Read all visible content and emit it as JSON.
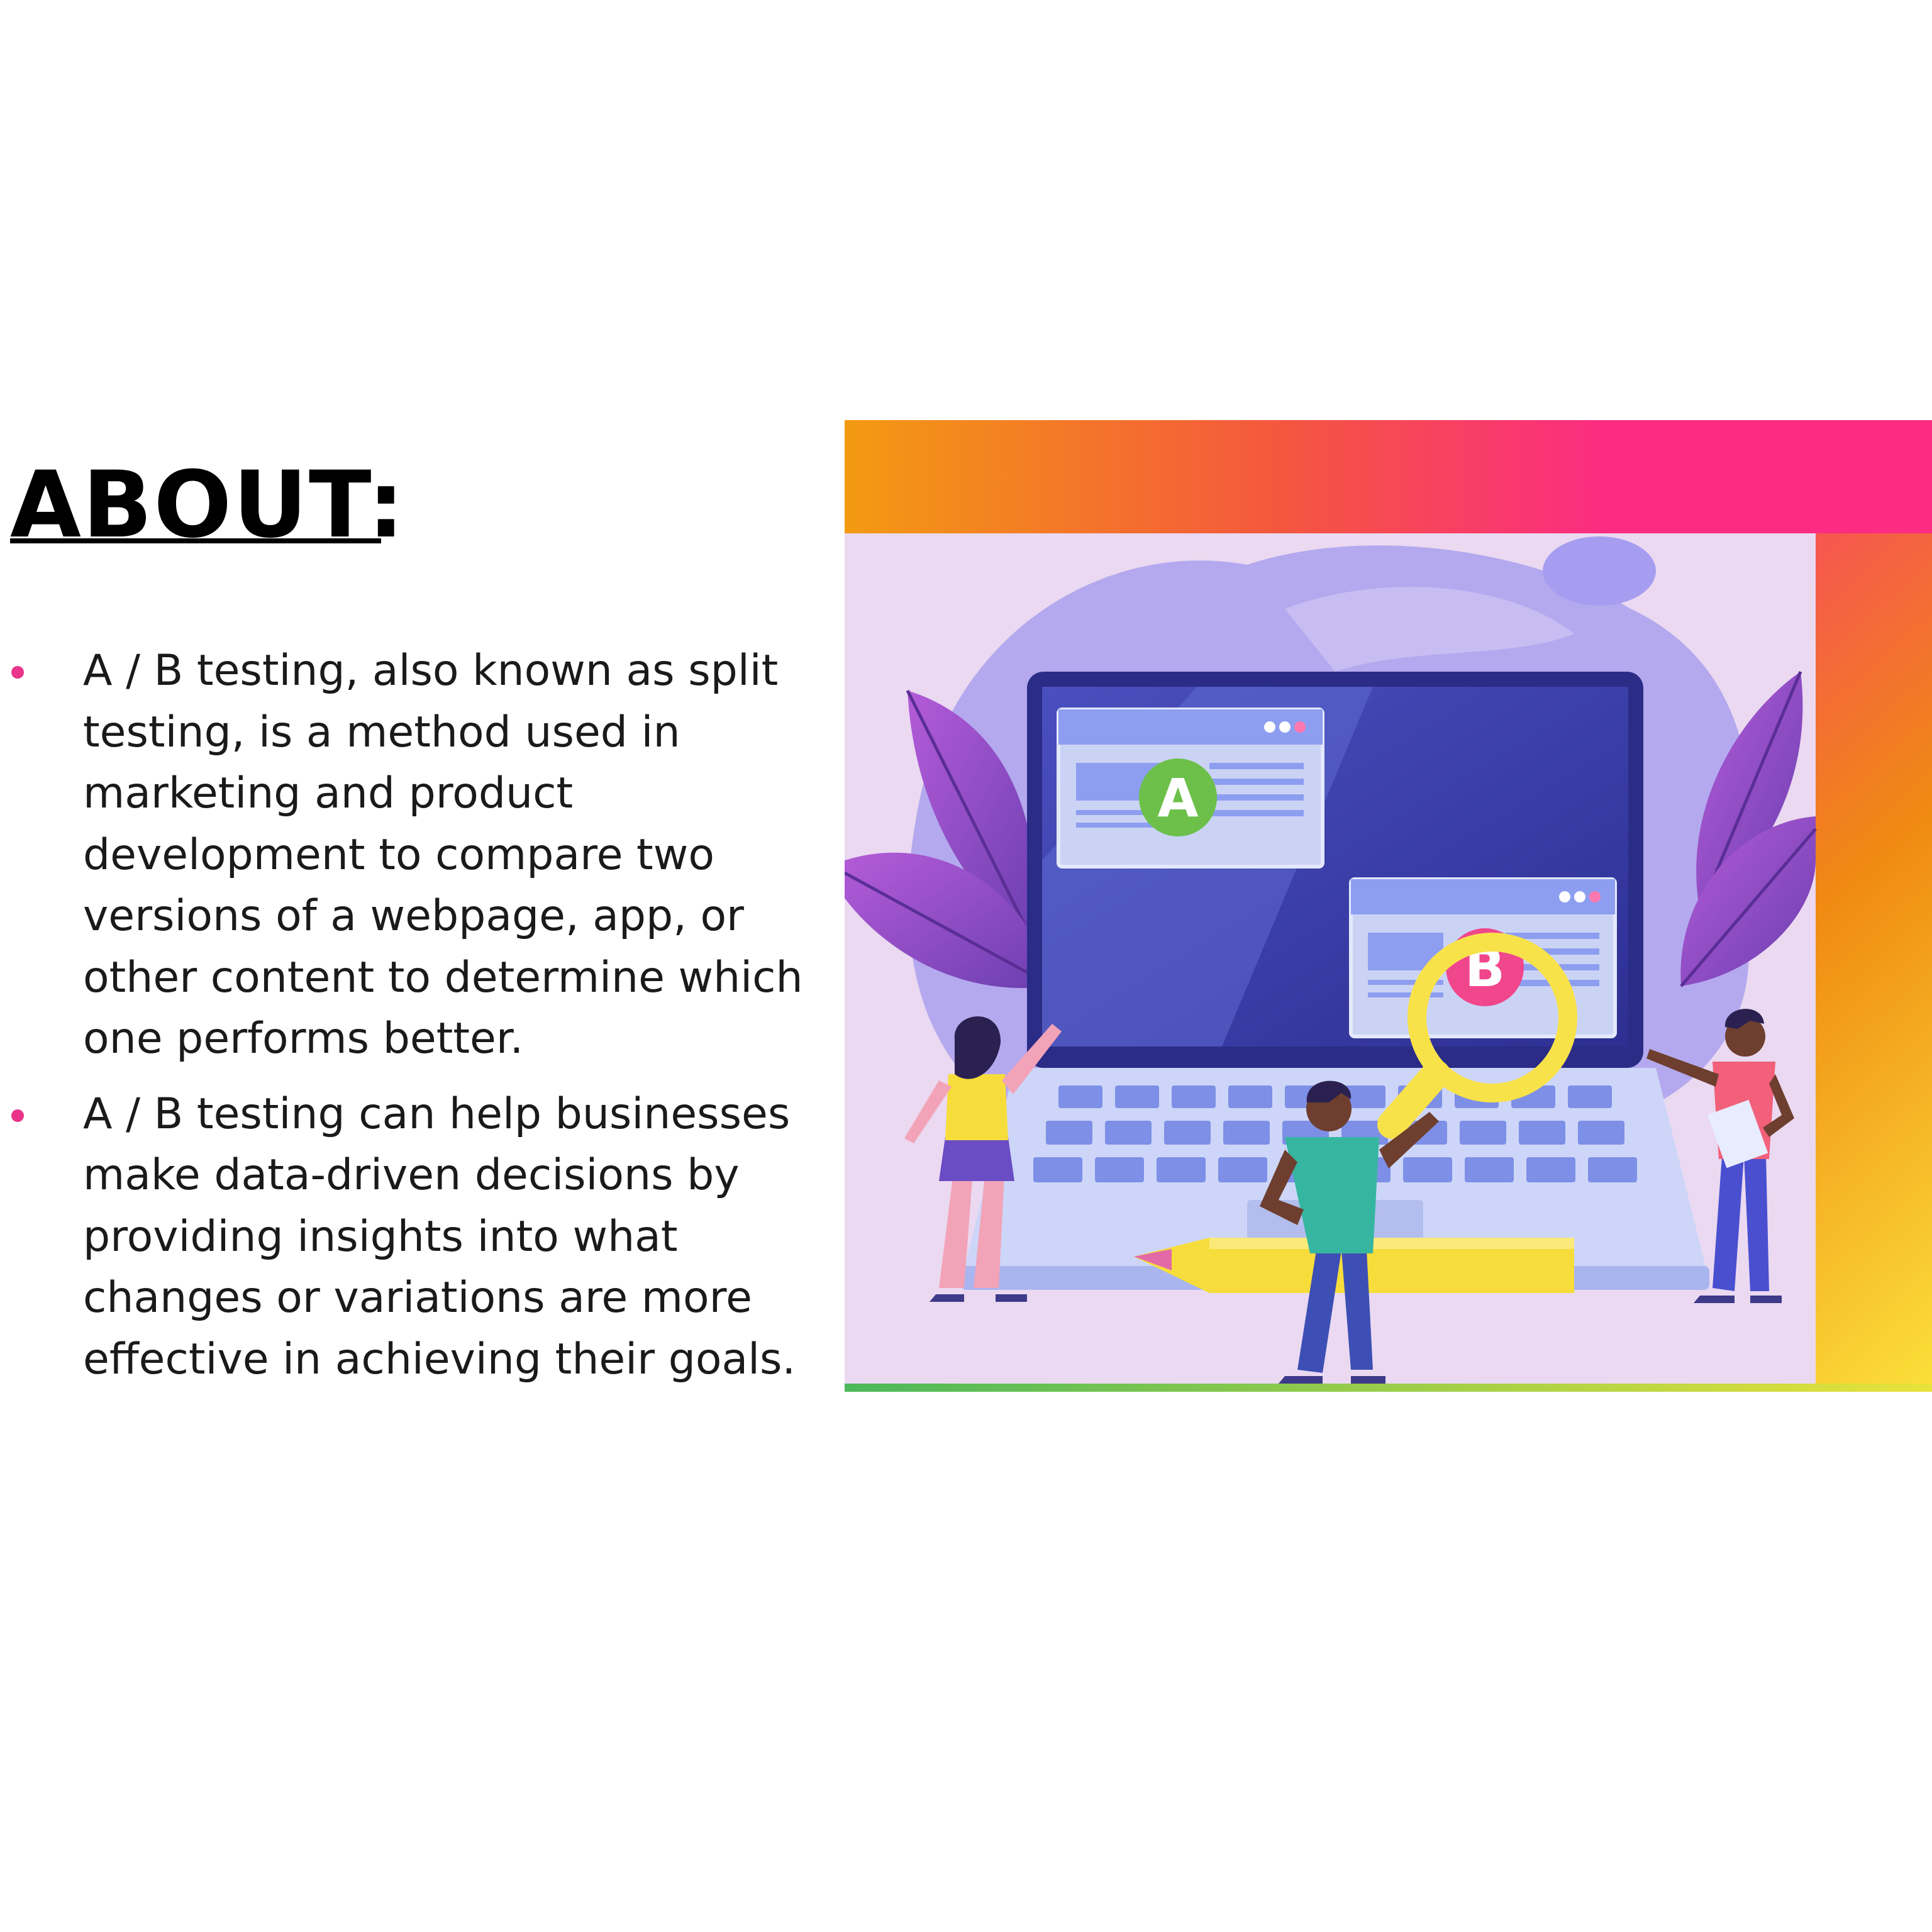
{
  "slide": {
    "title": "ABOUT:",
    "bullets": [
      "A / B testing, also known as split testing, is a method used in marketing and product development to compare two versions of a webpage, app, or other content to determine which one performs better.",
      "A / B testing can help businesses make data-driven decisions by providing insights into what changes or variations are more effective in achieving their goals."
    ]
  },
  "illustration": {
    "variant_a_letter": "A",
    "variant_b_letter": "B",
    "icon": "ab-testing-illustration",
    "colors": {
      "frame_orange": "#f08a12",
      "frame_pink": "#fb2c82",
      "frame_yellow": "#fbe03a",
      "accent_green": "#6cc04a",
      "screen_blue": "#3a3fa8",
      "bullet_pink": "#e8348a"
    }
  }
}
